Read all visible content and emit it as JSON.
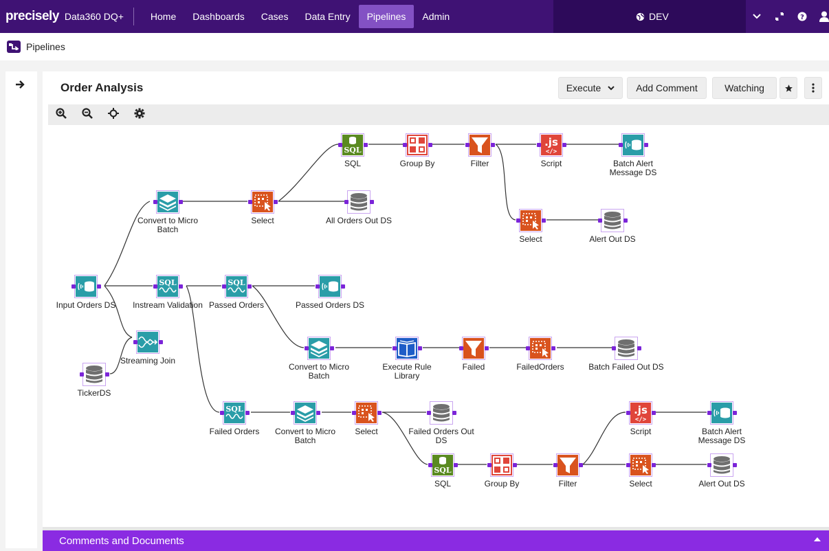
{
  "nav": {
    "brand": "precisely",
    "product": "Data360 DQ+",
    "items": [
      {
        "label": "Home"
      },
      {
        "label": "Dashboards"
      },
      {
        "label": "Cases"
      },
      {
        "label": "Data Entry"
      },
      {
        "label": "Pipelines",
        "active": true
      },
      {
        "label": "Admin"
      }
    ],
    "environment": "DEV",
    "icons": [
      "globe-icon",
      "chevron-down-icon",
      "expand-icon",
      "help-icon",
      "user-icon"
    ]
  },
  "subheader": {
    "icon": "pipelines-icon",
    "title": "Pipelines"
  },
  "panel": {
    "title": "Order Analysis",
    "buttons": {
      "execute": "Execute",
      "add_comment": "Add Comment",
      "watching": "Watching"
    },
    "toolbar": [
      "zoom-in-icon",
      "zoom-out-icon",
      "center-icon",
      "settings-icon"
    ],
    "comments_bar": "Comments and Documents"
  },
  "colors": {
    "nav_bg": "#3f1274",
    "nav_active": "#8351c4",
    "accent": "#8a2be2",
    "teal": "#2a9da8",
    "orange": "#d9531e",
    "green": "#5a8a21",
    "red": "#e0453a",
    "gray": "#6f6f6f",
    "blue": "#1e5cc7"
  },
  "pipeline": {
    "nodes": [
      {
        "id": "input",
        "label": "Input Orders DS",
        "icon": "stream-ds-icon"
      },
      {
        "id": "ticker",
        "label": "TickerDS",
        "icon": "database-icon"
      },
      {
        "id": "conv1",
        "label": "Convert to Micro Batch",
        "icon": "layers-icon"
      },
      {
        "id": "sel1",
        "label": "Select",
        "icon": "select-icon"
      },
      {
        "id": "sql1",
        "label": "SQL",
        "icon": "sql-icon"
      },
      {
        "id": "gb1",
        "label": "Group By",
        "icon": "group-by-icon"
      },
      {
        "id": "filt1",
        "label": "Filter",
        "icon": "filter-icon"
      },
      {
        "id": "scr1",
        "label": "Script",
        "icon": "script-icon"
      },
      {
        "id": "bam1",
        "label": "Batch Alert Message DS",
        "icon": "stream-ds-icon"
      },
      {
        "id": "allout",
        "label": "All Orders Out DS",
        "icon": "database-icon"
      },
      {
        "id": "sel2",
        "label": "Select",
        "icon": "select-icon"
      },
      {
        "id": "alert1",
        "label": "Alert Out DS",
        "icon": "database-icon"
      },
      {
        "id": "inval",
        "label": "Instream Validation",
        "icon": "stream-sql-icon"
      },
      {
        "id": "passed",
        "label": "Passed Orders",
        "icon": "stream-sql-icon"
      },
      {
        "id": "passedds",
        "label": "Passed Orders DS",
        "icon": "stream-ds-icon"
      },
      {
        "id": "join",
        "label": "Streaming Join",
        "icon": "streaming-join-icon"
      },
      {
        "id": "conv2",
        "label": "Convert to Micro Batch",
        "icon": "layers-icon"
      },
      {
        "id": "rule",
        "label": "Execute Rule Library",
        "icon": "rule-library-icon"
      },
      {
        "id": "failed",
        "label": "Failed",
        "icon": "filter-icon"
      },
      {
        "id": "failedord",
        "label": "FailedOrders",
        "icon": "select-icon"
      },
      {
        "id": "bfo",
        "label": "Batch Failed Out DS",
        "icon": "database-icon"
      },
      {
        "id": "failedorders",
        "label": "Failed Orders",
        "icon": "stream-sql-icon"
      },
      {
        "id": "conv3",
        "label": "Convert to Micro Batch",
        "icon": "layers-icon"
      },
      {
        "id": "sel3",
        "label": "Select",
        "icon": "select-icon"
      },
      {
        "id": "foout",
        "label": "Failed Orders Out DS",
        "icon": "database-icon"
      },
      {
        "id": "sql2",
        "label": "SQL",
        "icon": "sql-icon"
      },
      {
        "id": "gb2",
        "label": "Group By",
        "icon": "group-by-icon"
      },
      {
        "id": "filt2",
        "label": "Filter",
        "icon": "filter-icon"
      },
      {
        "id": "scr2",
        "label": "Script",
        "icon": "script-icon"
      },
      {
        "id": "bam2",
        "label": "Batch Alert Message DS",
        "icon": "stream-ds-icon"
      },
      {
        "id": "sel4",
        "label": "Select",
        "icon": "select-icon"
      },
      {
        "id": "alert2",
        "label": "Alert Out DS",
        "icon": "database-icon"
      }
    ],
    "edges": [
      [
        "input",
        "conv1"
      ],
      [
        "input",
        "inval"
      ],
      [
        "input",
        "join"
      ],
      [
        "ticker",
        "join"
      ],
      [
        "conv1",
        "sel1"
      ],
      [
        "sel1",
        "sql1"
      ],
      [
        "sel1",
        "allout"
      ],
      [
        "sql1",
        "gb1"
      ],
      [
        "gb1",
        "filt1"
      ],
      [
        "filt1",
        "scr1"
      ],
      [
        "scr1",
        "bam1"
      ],
      [
        "filt1",
        "sel2"
      ],
      [
        "sel2",
        "alert1"
      ],
      [
        "inval",
        "passed"
      ],
      [
        "inval",
        "failedorders"
      ],
      [
        "passed",
        "passedds"
      ],
      [
        "passed",
        "conv2"
      ],
      [
        "conv2",
        "rule"
      ],
      [
        "rule",
        "failed"
      ],
      [
        "failed",
        "failedord"
      ],
      [
        "failedord",
        "bfo"
      ],
      [
        "failedorders",
        "conv3"
      ],
      [
        "conv3",
        "sel3"
      ],
      [
        "sel3",
        "foout"
      ],
      [
        "sel3",
        "sql2"
      ],
      [
        "sql2",
        "gb2"
      ],
      [
        "gb2",
        "filt2"
      ],
      [
        "filt2",
        "scr2"
      ],
      [
        "scr2",
        "bam2"
      ],
      [
        "filt2",
        "sel4"
      ],
      [
        "sel4",
        "alert2"
      ]
    ]
  }
}
